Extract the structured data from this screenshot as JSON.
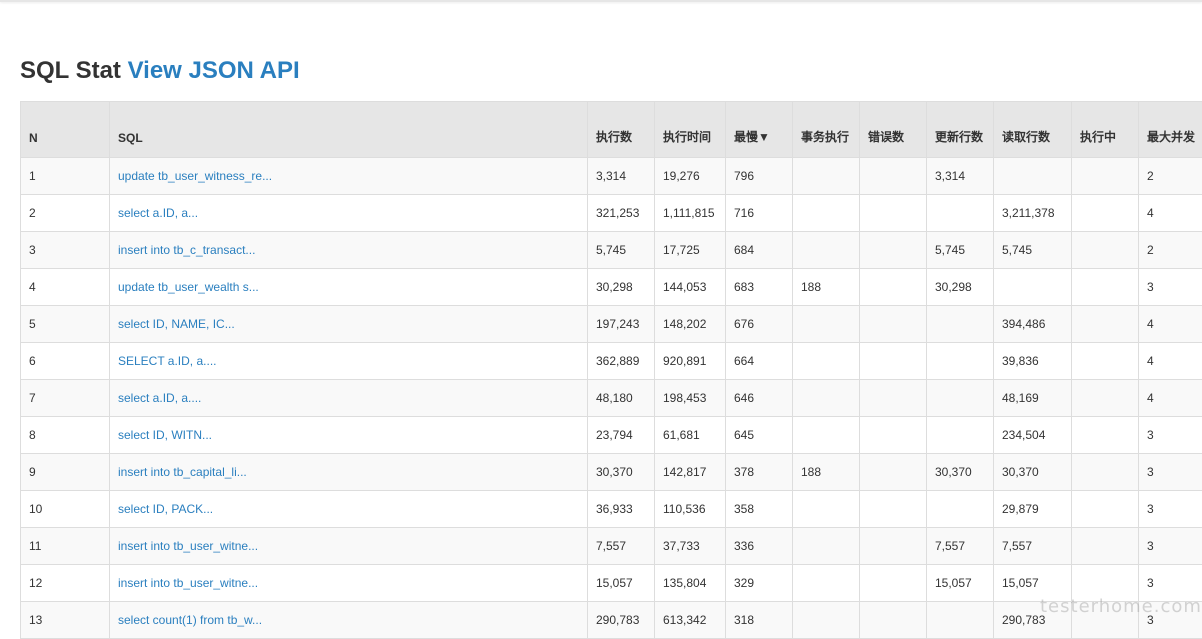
{
  "page": {
    "title": "SQL Stat",
    "api_link": "View JSON API"
  },
  "table": {
    "columns": [
      {
        "key": "n",
        "label": "N"
      },
      {
        "key": "sql",
        "label": "SQL"
      },
      {
        "key": "exec_count",
        "label": "执行数"
      },
      {
        "key": "exec_time",
        "label": "执行时间"
      },
      {
        "key": "slowest",
        "label": "最慢▼"
      },
      {
        "key": "txn_exec",
        "label": "事务执行"
      },
      {
        "key": "errors",
        "label": "错误数"
      },
      {
        "key": "update_rows",
        "label": "更新行数"
      },
      {
        "key": "fetch_rows",
        "label": "读取行数"
      },
      {
        "key": "running",
        "label": "执行中"
      },
      {
        "key": "max_concurrent",
        "label": "最大并发"
      }
    ],
    "rows": [
      {
        "n": "1",
        "sql": "update tb_user_witness_re...",
        "exec_count": "3,314",
        "exec_time": "19,276",
        "slowest": "796",
        "txn_exec": "",
        "errors": "",
        "update_rows": "3,314",
        "fetch_rows": "",
        "running": "",
        "max_concurrent": "2"
      },
      {
        "n": "2",
        "sql": "select a.ID, a...",
        "exec_count": "321,253",
        "exec_time": "1,111,815",
        "slowest": "716",
        "txn_exec": "",
        "errors": "",
        "update_rows": "",
        "fetch_rows": "3,211,378",
        "running": "",
        "max_concurrent": "4"
      },
      {
        "n": "3",
        "sql": "insert into tb_c_transact...",
        "exec_count": "5,745",
        "exec_time": "17,725",
        "slowest": "684",
        "txn_exec": "",
        "errors": "",
        "update_rows": "5,745",
        "fetch_rows": "5,745",
        "running": "",
        "max_concurrent": "2"
      },
      {
        "n": "4",
        "sql": "update tb_user_wealth s...",
        "exec_count": "30,298",
        "exec_time": "144,053",
        "slowest": "683",
        "txn_exec": "188",
        "errors": "",
        "update_rows": "30,298",
        "fetch_rows": "",
        "running": "",
        "max_concurrent": "3"
      },
      {
        "n": "5",
        "sql": "select ID, NAME, IC...",
        "exec_count": "197,243",
        "exec_time": "148,202",
        "slowest": "676",
        "txn_exec": "",
        "errors": "",
        "update_rows": "",
        "fetch_rows": "394,486",
        "running": "",
        "max_concurrent": "4"
      },
      {
        "n": "6",
        "sql": "SELECT a.ID, a....",
        "exec_count": "362,889",
        "exec_time": "920,891",
        "slowest": "664",
        "txn_exec": "",
        "errors": "",
        "update_rows": "",
        "fetch_rows": "39,836",
        "running": "",
        "max_concurrent": "4"
      },
      {
        "n": "7",
        "sql": "select a.ID, a....",
        "exec_count": "48,180",
        "exec_time": "198,453",
        "slowest": "646",
        "txn_exec": "",
        "errors": "",
        "update_rows": "",
        "fetch_rows": "48,169",
        "running": "",
        "max_concurrent": "4"
      },
      {
        "n": "8",
        "sql": "select ID, WITN...",
        "exec_count": "23,794",
        "exec_time": "61,681",
        "slowest": "645",
        "txn_exec": "",
        "errors": "",
        "update_rows": "",
        "fetch_rows": "234,504",
        "running": "",
        "max_concurrent": "3"
      },
      {
        "n": "9",
        "sql": "insert into tb_capital_li...",
        "exec_count": "30,370",
        "exec_time": "142,817",
        "slowest": "378",
        "txn_exec": "188",
        "errors": "",
        "update_rows": "30,370",
        "fetch_rows": "30,370",
        "running": "",
        "max_concurrent": "3"
      },
      {
        "n": "10",
        "sql": "select ID, PACK...",
        "exec_count": "36,933",
        "exec_time": "110,536",
        "slowest": "358",
        "txn_exec": "",
        "errors": "",
        "update_rows": "",
        "fetch_rows": "29,879",
        "running": "",
        "max_concurrent": "3"
      },
      {
        "n": "11",
        "sql": "insert into tb_user_witne...",
        "exec_count": "7,557",
        "exec_time": "37,733",
        "slowest": "336",
        "txn_exec": "",
        "errors": "",
        "update_rows": "7,557",
        "fetch_rows": "7,557",
        "running": "",
        "max_concurrent": "3"
      },
      {
        "n": "12",
        "sql": "insert into tb_user_witne...",
        "exec_count": "15,057",
        "exec_time": "135,804",
        "slowest": "329",
        "txn_exec": "",
        "errors": "",
        "update_rows": "15,057",
        "fetch_rows": "15,057",
        "running": "",
        "max_concurrent": "3"
      },
      {
        "n": "13",
        "sql": "select count(1) from tb_w...",
        "exec_count": "290,783",
        "exec_time": "613,342",
        "slowest": "318",
        "txn_exec": "",
        "errors": "",
        "update_rows": "",
        "fetch_rows": "290,783",
        "running": "",
        "max_concurrent": "3"
      }
    ]
  },
  "watermark": "testerhome.com",
  "colors": {
    "link": "#2a7fbf",
    "header_bg": "#e6e6e6",
    "stripe": "#f9f9f9",
    "border": "#dddddd"
  }
}
